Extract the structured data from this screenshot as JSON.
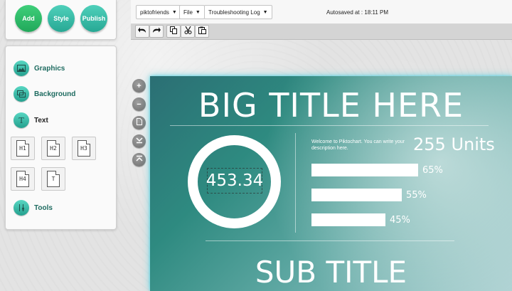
{
  "actions": {
    "add": "Add",
    "style": "Style",
    "publish": "Publish"
  },
  "tools": {
    "graphics": "Graphics",
    "background": "Background",
    "text": "Text",
    "tools": "Tools",
    "headings": [
      "H1",
      "H2",
      "H3",
      "H4",
      "T"
    ]
  },
  "toolbar": {
    "account": "piktofriends",
    "file": "File",
    "log": "Troubleshooting Log",
    "autosave": "Autosaved at : 18:11 PM"
  },
  "icons": {
    "undo": "undo-icon",
    "redo": "redo-icon",
    "copy": "copy-icon",
    "cut": "cut-icon",
    "paste": "paste-icon",
    "zoom_in": "plus-icon",
    "zoom_out": "minus-icon"
  },
  "canvas": {
    "title": "BIG TITLE HERE",
    "ring_value": "453.34",
    "description": "Welcome to Piktochart. You can write your description here.",
    "units": "255 Units",
    "bars": [
      {
        "label": "65%",
        "value": 65
      },
      {
        "label": "55%",
        "value": 55
      },
      {
        "label": "45%",
        "value": 45
      }
    ],
    "subtitle": "SUB TITLE"
  },
  "colors": {
    "add": "#2bb866",
    "accent": "#33b8a4",
    "label": "#1e6b60"
  }
}
